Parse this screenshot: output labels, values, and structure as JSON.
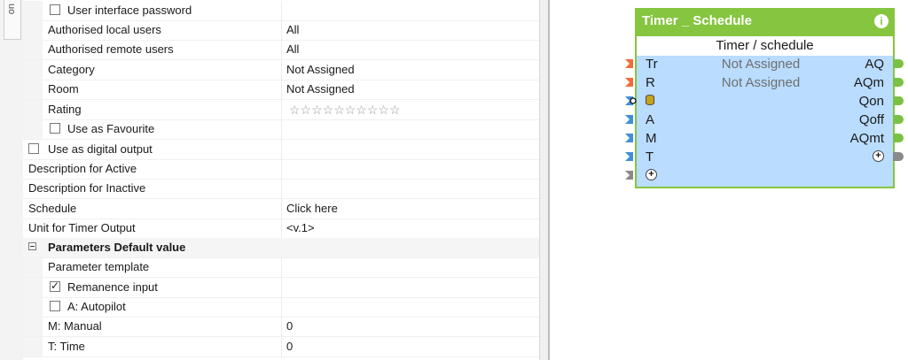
{
  "left_tab": {
    "label": "on"
  },
  "properties": [
    {
      "label": "User interface password",
      "value": "",
      "checkbox": true,
      "checked": false,
      "indent": 1
    },
    {
      "label": "Authorised local users",
      "value": "All",
      "indent": 1
    },
    {
      "label": "Authorised remote users",
      "value": "All",
      "indent": 1
    },
    {
      "label": "Category",
      "value": "Not Assigned",
      "indent": 1
    },
    {
      "label": "Room",
      "value": "Not Assigned",
      "indent": 1
    },
    {
      "label": "Rating",
      "value": "☆☆☆☆☆☆☆☆☆☆",
      "indent": 1
    },
    {
      "label": "Use as Favourite",
      "value": "",
      "checkbox": true,
      "checked": false,
      "indent": 1
    },
    {
      "label": "Use as digital output",
      "value": "",
      "checkbox": true,
      "checked": false,
      "indent": 0
    },
    {
      "label": "Description for Active",
      "value": "",
      "indent": 0
    },
    {
      "label": "Description for Inactive",
      "value": "",
      "indent": 0
    },
    {
      "label": "Schedule",
      "value": "Click here",
      "indent": 0
    },
    {
      "label": "Unit for Timer Output",
      "value": "<v.1>",
      "indent": 0
    },
    {
      "label": "Parameters Default value",
      "value": "",
      "group": true
    },
    {
      "label": "Parameter template",
      "value": "",
      "indent": 1
    },
    {
      "label": "Remanence input",
      "value": "",
      "checkbox": true,
      "checked": true,
      "indent": 1
    },
    {
      "label": "A: Autopilot",
      "value": "",
      "checkbox": true,
      "checked": false,
      "indent": 1
    },
    {
      "label": "M: Manual",
      "value": "0",
      "indent": 1
    },
    {
      "label": "T: Time",
      "value": "0",
      "indent": 1
    }
  ],
  "block": {
    "title": "Timer _ Schedule",
    "info_icon": "info-icon",
    "subtitle": "Timer / schedule",
    "inputs": [
      "Tr",
      "R",
      "",
      "A",
      "M",
      "T",
      ""
    ],
    "outputs": [
      "AQ",
      "AQm",
      "Qon",
      "Qoff",
      "AQmt",
      ""
    ],
    "params": [
      "Not Assigned",
      "Not Assigned"
    ],
    "colors": {
      "header": "#86c540",
      "body": "#b9dcff",
      "input_red": "#f26b3a",
      "input_blue": "#3f8fd8",
      "input_gray": "#8a8a8a",
      "output_green": "#7ac143"
    }
  }
}
